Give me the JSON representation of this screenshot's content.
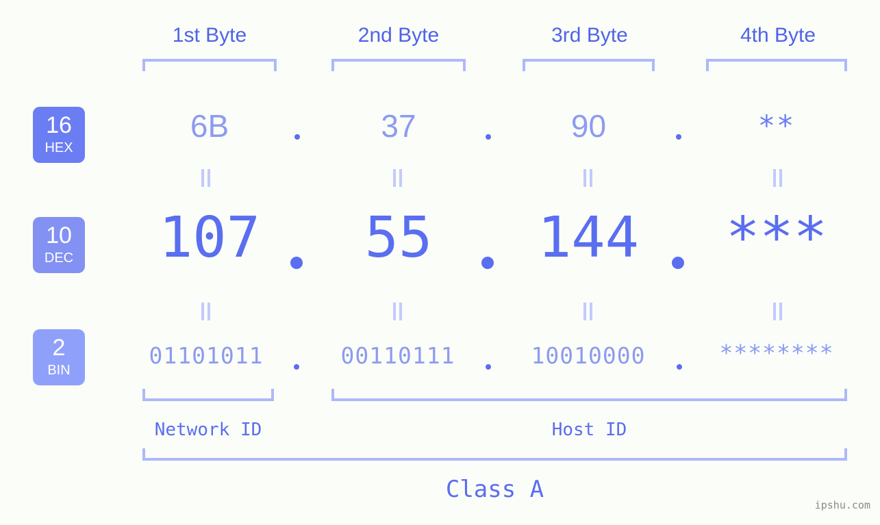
{
  "page": {
    "background_color": "#fbfdf8",
    "accent_color": "#5a6ef0",
    "light_accent_color": "#aeb8fb",
    "badge_color": "#6b7df3",
    "badge_color_light": "#8c9bf0"
  },
  "headers": [
    {
      "label": "1st Byte"
    },
    {
      "label": "2nd Byte"
    },
    {
      "label": "3rd Byte"
    },
    {
      "label": "4th Byte"
    }
  ],
  "rows": {
    "hex": {
      "badge_number": "16",
      "badge_name": "HEX",
      "values": [
        "6B",
        "37",
        "90",
        "**"
      ]
    },
    "dec": {
      "badge_number": "10",
      "badge_name": "DEC",
      "values": [
        "107",
        "55",
        "144",
        "***"
      ]
    },
    "bin": {
      "badge_number": "2",
      "badge_name": "BIN",
      "values": [
        "01101011",
        "00110111",
        "10010000",
        "********"
      ]
    }
  },
  "separator": ".",
  "equals_mark": "||",
  "sections": {
    "network_id": "Network ID",
    "host_id": "Host ID",
    "class": "Class A"
  },
  "watermark": "ipshu.com"
}
